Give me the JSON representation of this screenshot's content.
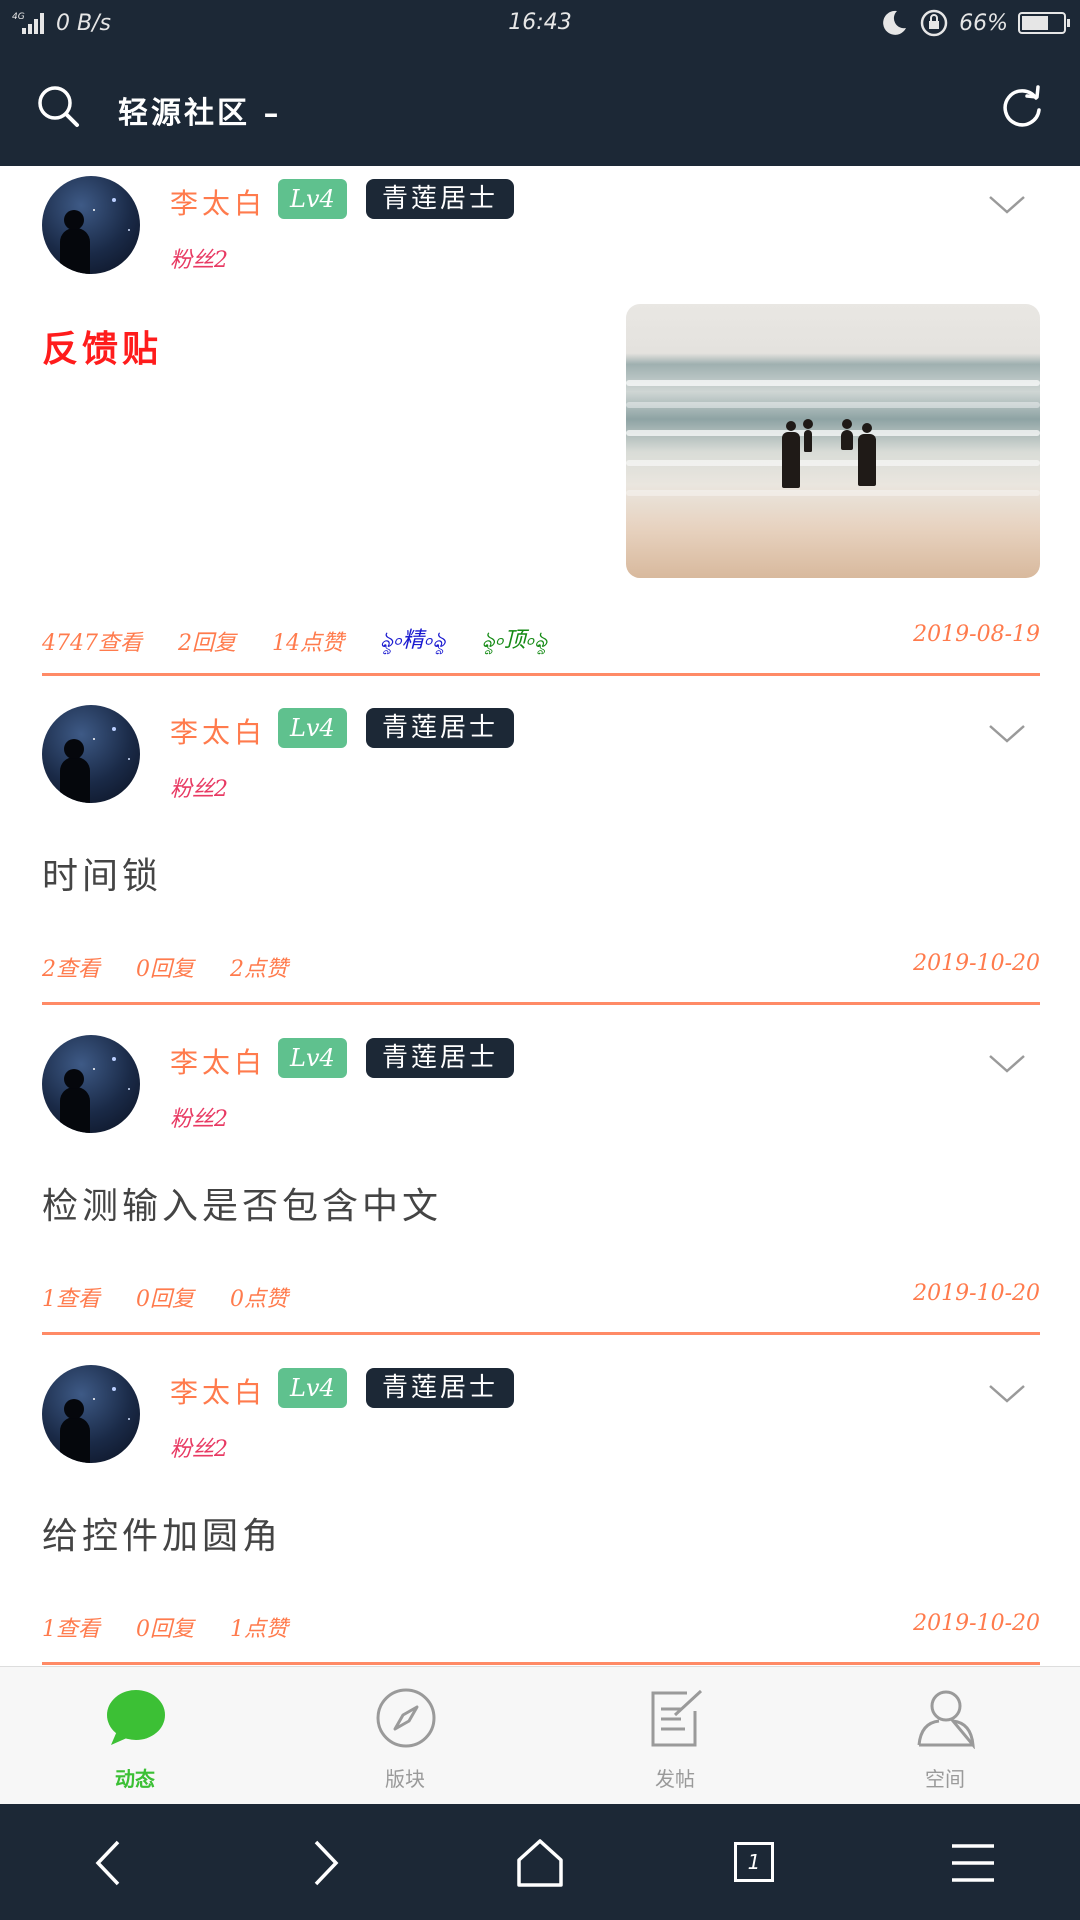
{
  "status_bar": {
    "network": "4G",
    "speed": "0 B/s",
    "time": "16:43",
    "battery": "66%",
    "battery_level": 0.66
  },
  "header": {
    "title": "轻源社区 –",
    "search_icon": "search-icon",
    "refresh_icon": "refresh-icon"
  },
  "posts": [
    {
      "username": "李太白",
      "level": "Lv4",
      "user_title": "青莲居士",
      "fans": "粉丝2",
      "title": "反馈贴",
      "views": "4747查看",
      "replies": "2回复",
      "likes": "14点赞",
      "tag_featured": "ৡ৹精৹ৡ",
      "tag_pinned": "ৡ৹顶৹ৡ",
      "date": "2019-08-19"
    },
    {
      "username": "李太白",
      "level": "Lv4",
      "user_title": "青莲居士",
      "fans": "粉丝2",
      "title": "时间锁",
      "views": "2查看",
      "replies": "0回复",
      "likes": "2点赞",
      "date": "2019-10-20"
    },
    {
      "username": "李太白",
      "level": "Lv4",
      "user_title": "青莲居士",
      "fans": "粉丝2",
      "title": "检测输入是否包含中文",
      "views": "1查看",
      "replies": "0回复",
      "likes": "0点赞",
      "date": "2019-10-20"
    },
    {
      "username": "李太白",
      "level": "Lv4",
      "user_title": "青莲居士",
      "fans": "粉丝2",
      "title": "给控件加圆角",
      "views": "1查看",
      "replies": "0回复",
      "likes": "1点赞",
      "date": "2019-10-20"
    }
  ],
  "bottom_nav": {
    "items": [
      {
        "label": "动态",
        "icon": "chat-bubble-icon",
        "active": true
      },
      {
        "label": "版块",
        "icon": "compass-icon",
        "active": false
      },
      {
        "label": "发帖",
        "icon": "edit-icon",
        "active": false
      },
      {
        "label": "空间",
        "icon": "user-icon",
        "active": false
      }
    ],
    "active_color": "#3cc035",
    "inactive_color": "#9a9a9a"
  },
  "system_nav": {
    "tab_count": "1",
    "icons": [
      "back-icon",
      "forward-icon",
      "home-icon",
      "tabs-icon",
      "menu-icon"
    ]
  },
  "colors": {
    "header_bg": "#1c2836",
    "accent_orange": "#ff7b4d",
    "level_green": "#5fc18e",
    "fans_red": "#e83a63",
    "feedback_red": "#ff1c1c"
  }
}
